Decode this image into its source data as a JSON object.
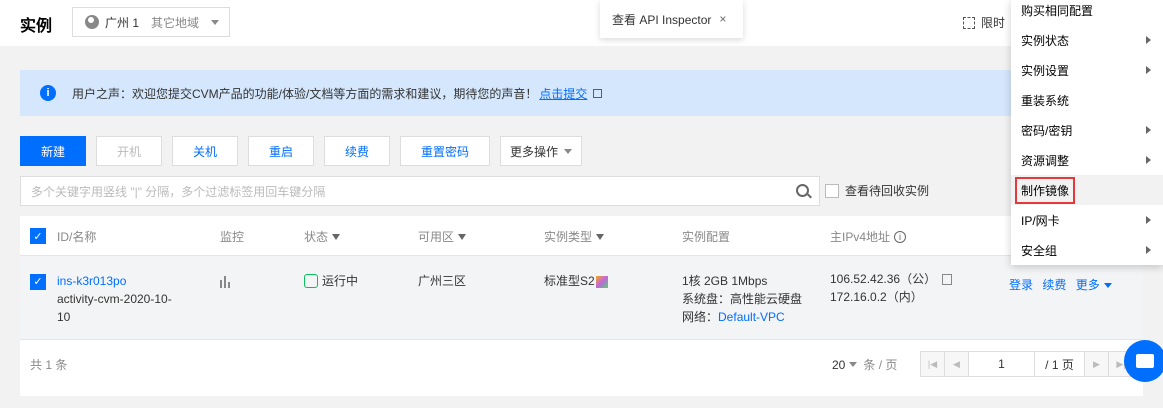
{
  "header": {
    "title": "实例",
    "region": {
      "main": "广州 1",
      "other": "其它地域"
    },
    "api_inspector": "查看 API Inspector",
    "api_close": "×",
    "limited_label": "限时"
  },
  "notice": {
    "info": "i",
    "text": "用户之声：欢迎您提交CVM产品的功能/体验/文档等方面的需求和建议，期待您的声音！",
    "link": "点击提交"
  },
  "toolbar": {
    "new": "新建",
    "power_on": "开机",
    "power_off": "关机",
    "restart": "重启",
    "renew": "续费",
    "reset_password": "重置密码",
    "more_actions": "更多操作"
  },
  "search": {
    "placeholder": "多个关键字用竖线 \"|\" 分隔，多个过滤标签用回车键分隔",
    "recycle_label": "查看待回收实例"
  },
  "table": {
    "headers": {
      "id_name": "ID/名称",
      "monitor": "监控",
      "status": "状态",
      "zone": "可用区",
      "instance_type": "实例类型",
      "config": "实例配置",
      "ip": "主IPv4地址"
    },
    "row": {
      "id": "ins-k3r013po",
      "name_line1": "activity-cvm-2020-10-",
      "name_line2": "10",
      "status": "运行中",
      "zone": "广州三区",
      "instance_type": "标准型S2",
      "config_line1": "1核 2GB 1Mbps",
      "config_line2": "系统盘：高性能云硬盘",
      "network_label": "网络：",
      "network_value": "Default-VPC",
      "ip_public": "106.52.42.36（公）",
      "ip_private": "172.16.0.2（内）",
      "login": "登录",
      "renew": "续费",
      "more": "更多"
    }
  },
  "footer": {
    "total": "共 1 条",
    "page_size": "20",
    "per_page": "条 / 页",
    "current_page": "1",
    "total_pages": "/ 1 页"
  },
  "menu": {
    "items": [
      {
        "label": "购买相同配置",
        "submenu": false
      },
      {
        "label": "实例状态",
        "submenu": true
      },
      {
        "label": "实例设置",
        "submenu": true
      },
      {
        "label": "重装系统",
        "submenu": false
      },
      {
        "label": "密码/密钥",
        "submenu": true
      },
      {
        "label": "资源调整",
        "submenu": true
      },
      {
        "label": "制作镜像",
        "submenu": false,
        "highlighted": true
      },
      {
        "label": "IP/网卡",
        "submenu": true
      },
      {
        "label": "安全组",
        "submenu": true
      }
    ]
  },
  "colors": {
    "accent": "#006eff",
    "notice_bg": "#d5e7fd",
    "running": "#0abf5b",
    "highlight_border": "#e4393c"
  }
}
